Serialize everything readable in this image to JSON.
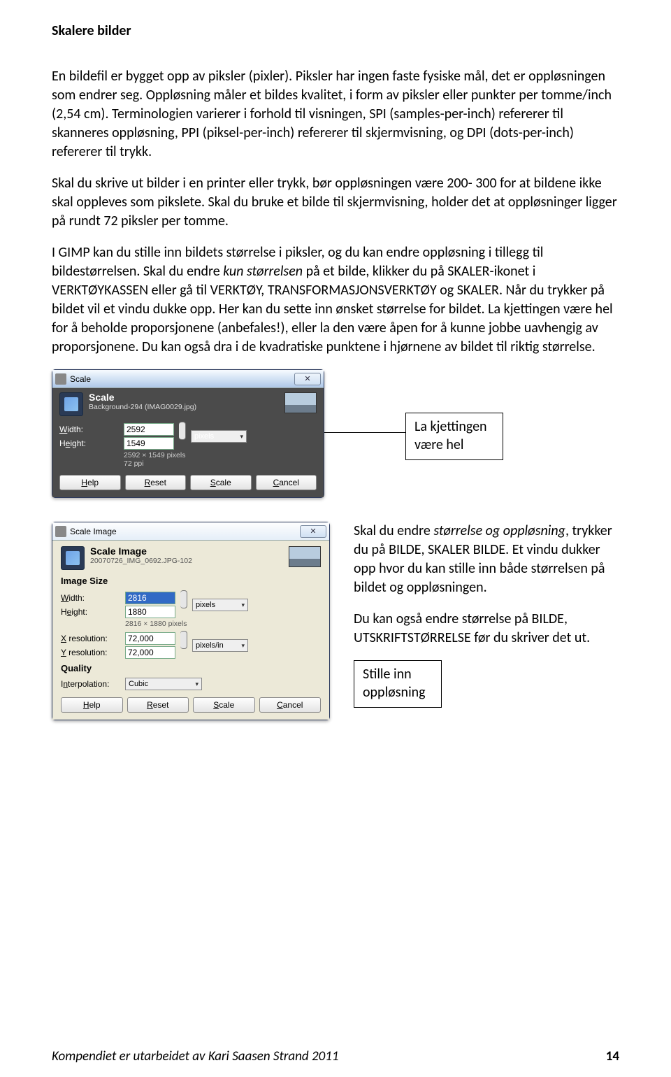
{
  "title": "Skalere bilder",
  "p1": "En bildefil er bygget opp av piksler (pixler). Piksler har ingen faste fysiske mål, det er oppløsningen som endrer seg. Oppløsning måler et bildes kvalitet, i form av piksler eller punkter per tomme/inch (2,54 cm). Terminologien varierer i forhold til visningen, SPI (samples-per-inch) refererer til skanneres oppløsning, PPI (piksel-per-inch) refererer til skjermvisning, og DPI (dots-per-inch) refererer til trykk.",
  "p2": "Skal du skrive ut bilder i en printer eller trykk, bør oppløsningen være 200- 300 for at bildene ikke skal oppleves som pikslete. Skal du bruke et bilde til skjermvisning, holder det at oppløsninger ligger på rundt 72 piksler per tomme.",
  "p3a": "I GIMP kan du stille inn bildets størrelse i piksler, og du kan endre oppløsning i tillegg til bildestørrelsen. Skal du endre ",
  "p3b": "kun størrelsen",
  "p3c": " på et bilde, klikker du på SKALER-ikonet i VERKTØYKASSEN eller gå til VERKTØY, TRANSFORMASJONSVERKTØY og SKALER. Når du trykker på bildet vil et vindu dukke opp. Her kan du sette inn ønsket størrelse for bildet. La kjettingen være hel for å beholde proporsjonene (anbefales!), eller la den være åpen for å kunne jobbe uavhengig av proporsjonene. Du kan også dra i de kvadratiske punktene i hjørnene av bildet til riktig størrelse.",
  "callout1": "La kjettingen være hel",
  "p4a": "Skal du endre ",
  "p4b": "størrelse og oppløsning",
  "p4c": ", trykker du på BILDE, SKALER BILDE. Et vindu dukker opp hvor du kan stille inn både størrelsen på bildet og oppløsningen.",
  "p5": "Du kan også endre størrelse på BILDE, UTSKRIFTSTØRRELSE før du skriver det ut.",
  "callout2": "Stille inn oppløsning",
  "win1": {
    "title": "Scale",
    "head": "Scale",
    "sub": "Background-294 (IMAG0029.jpg)",
    "width_lbl": "Width:",
    "width_val": "2592",
    "height_lbl": "Height:",
    "height_val": "1549",
    "unit": "pixels",
    "hint1": "2592 × 1549 pixels",
    "hint2": "72 ppi",
    "help": "Help",
    "reset": "Reset",
    "scale": "Scale",
    "cancel": "Cancel"
  },
  "win2": {
    "title": "Scale Image",
    "head": "Scale Image",
    "sub": "20070726_IMG_0692.JPG-102",
    "imgsize": "Image Size",
    "width_lbl": "Width:",
    "width_val": "2816",
    "height_lbl": "Height:",
    "height_val": "1880",
    "unit1": "pixels",
    "hint": "2816 × 1880 pixels",
    "xres_lbl": "X resolution:",
    "xres_val": "72,000",
    "yres_lbl": "Y resolution:",
    "yres_val": "72,000",
    "unit2": "pixels/in",
    "quality": "Quality",
    "interp_lbl": "Interpolation:",
    "interp_val": "Cubic",
    "help": "Help",
    "reset": "Reset",
    "scale": "Scale",
    "cancel": "Cancel"
  },
  "footer_text": "Kompendiet er utarbeidet av Kari Saasen Strand 2011",
  "page_number": "14"
}
